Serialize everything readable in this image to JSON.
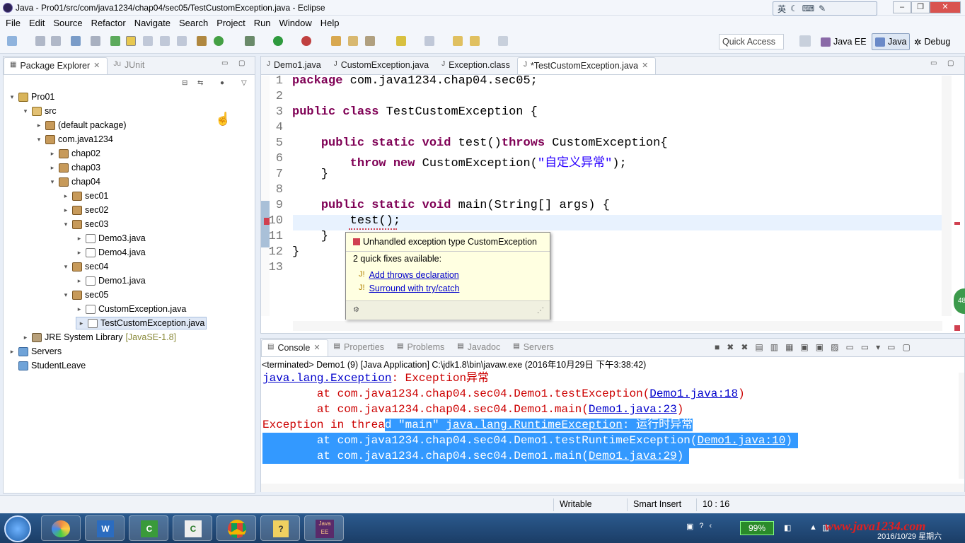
{
  "window": {
    "title": "Java - Pro01/src/com/java1234/chap04/sec05/TestCustomException.java - Eclipse",
    "ime_label": "英"
  },
  "menu": [
    "File",
    "Edit",
    "Source",
    "Refactor",
    "Navigate",
    "Search",
    "Project",
    "Run",
    "Window",
    "Help"
  ],
  "toolbar": {
    "quick_access": "Quick Access",
    "perspectives": [
      "Java EE",
      "Java",
      "Debug"
    ]
  },
  "explorer": {
    "tabs": [
      "Package Explorer",
      "JUnit"
    ],
    "tree": [
      {
        "label": "Pro01",
        "icon": "project-icon",
        "depth": 0,
        "twisty": "▾"
      },
      {
        "label": "src",
        "icon": "source-folder-icon",
        "depth": 1,
        "twisty": "▾"
      },
      {
        "label": "(default package)",
        "icon": "package-icon",
        "depth": 2,
        "twisty": "▸"
      },
      {
        "label": "com.java1234",
        "icon": "package-icon",
        "depth": 2,
        "twisty": "▾"
      },
      {
        "label": "chap02",
        "icon": "package-icon",
        "depth": 3,
        "twisty": "▸"
      },
      {
        "label": "chap03",
        "icon": "package-icon",
        "depth": 3,
        "twisty": "▸"
      },
      {
        "label": "chap04",
        "icon": "package-icon",
        "depth": 3,
        "twisty": "▾"
      },
      {
        "label": "sec01",
        "icon": "package-icon",
        "depth": 4,
        "twisty": "▸"
      },
      {
        "label": "sec02",
        "icon": "package-icon",
        "depth": 4,
        "twisty": "▸"
      },
      {
        "label": "sec03",
        "icon": "package-icon",
        "depth": 4,
        "twisty": "▾"
      },
      {
        "label": "Demo3.java",
        "icon": "java-file-icon",
        "depth": 5,
        "twisty": "▸"
      },
      {
        "label": "Demo4.java",
        "icon": "java-file-icon",
        "depth": 5,
        "twisty": "▸"
      },
      {
        "label": "sec04",
        "icon": "package-icon",
        "depth": 4,
        "twisty": "▾"
      },
      {
        "label": "Demo1.java",
        "icon": "java-file-icon",
        "depth": 5,
        "twisty": "▸"
      },
      {
        "label": "sec05",
        "icon": "package-icon",
        "depth": 4,
        "twisty": "▾"
      },
      {
        "label": "CustomException.java",
        "icon": "java-file-icon",
        "depth": 5,
        "twisty": "▸"
      },
      {
        "label": "TestCustomException.java",
        "icon": "java-file-icon",
        "depth": 5,
        "twisty": "▸",
        "selected": true
      },
      {
        "label": "JRE System Library",
        "suffix": "[JavaSE-1.8]",
        "icon": "library-icon",
        "depth": 1,
        "twisty": "▸"
      },
      {
        "label": "Servers",
        "icon": "folder-icon",
        "depth": 0,
        "twisty": "▸"
      },
      {
        "label": "StudentLeave",
        "icon": "folder-icon",
        "depth": 0,
        "twisty": ""
      }
    ]
  },
  "editor": {
    "tabs": [
      {
        "label": "Demo1.java",
        "active": false
      },
      {
        "label": "CustomException.java",
        "active": false
      },
      {
        "label": "Exception.class",
        "active": false
      },
      {
        "label": "*TestCustomException.java",
        "active": true
      }
    ],
    "line_numbers": [
      "1",
      "2",
      "3",
      "4",
      "5",
      "6",
      "7",
      "8",
      "9",
      "10",
      "11",
      "12",
      "13"
    ],
    "lines": [
      [
        {
          "t": "package",
          "c": "kw"
        },
        {
          "t": " com.java1234.chap04.sec05;"
        }
      ],
      [],
      [
        {
          "t": "public",
          "c": "kw"
        },
        {
          "t": " "
        },
        {
          "t": "class",
          "c": "kw"
        },
        {
          "t": " TestCustomException {"
        }
      ],
      [],
      [
        {
          "t": "    "
        },
        {
          "t": "public",
          "c": "kw"
        },
        {
          "t": " "
        },
        {
          "t": "static",
          "c": "kw"
        },
        {
          "t": " "
        },
        {
          "t": "void",
          "c": "kw"
        },
        {
          "t": " test()"
        },
        {
          "t": "throws",
          "c": "kw"
        },
        {
          "t": " CustomException{"
        }
      ],
      [
        {
          "t": "        "
        },
        {
          "t": "throw",
          "c": "kw"
        },
        {
          "t": " "
        },
        {
          "t": "new",
          "c": "kw"
        },
        {
          "t": " CustomException("
        },
        {
          "t": "\"自定义异常\"",
          "c": "str"
        },
        {
          "t": ");"
        }
      ],
      [
        {
          "t": "    }"
        }
      ],
      [],
      [
        {
          "t": "    "
        },
        {
          "t": "public",
          "c": "kw"
        },
        {
          "t": " "
        },
        {
          "t": "static",
          "c": "kw"
        },
        {
          "t": " "
        },
        {
          "t": "void",
          "c": "kw"
        },
        {
          "t": " main(String[] args) {"
        }
      ],
      [
        {
          "t": "        test();"
        }
      ],
      [
        {
          "t": "    }"
        }
      ],
      [
        {
          "t": "}"
        }
      ],
      []
    ],
    "hover": {
      "title": "Unhandled exception type CustomException",
      "subtitle": "2 quick fixes available:",
      "fixes": [
        "Add throws declaration",
        "Surround with try/catch"
      ]
    }
  },
  "console": {
    "tabs": [
      "Console",
      "Properties",
      "Problems",
      "Javadoc",
      "Servers"
    ],
    "header": "<terminated> Demo1 (9) [Java Application] C:\\jdk1.8\\bin\\javaw.exe (2016年10月29日 下午3:38:42)",
    "lines": [
      {
        "parts": [
          {
            "t": "java.lang.Exception",
            "c": "clink"
          },
          {
            "t": ": Exception异常",
            "c": "err"
          }
        ],
        "sel": false
      },
      {
        "parts": [
          {
            "t": "        at com.java1234.chap04.sec04.Demo1.testException(",
            "c": "err"
          },
          {
            "t": "Demo1.java:18",
            "c": "clink"
          },
          {
            "t": ")",
            "c": "err"
          }
        ],
        "sel": false
      },
      {
        "parts": [
          {
            "t": "        at com.java1234.chap04.sec04.Demo1.main(",
            "c": "err"
          },
          {
            "t": "Demo1.java:23",
            "c": "clink"
          },
          {
            "t": ")",
            "c": "err"
          }
        ],
        "sel": false
      },
      {
        "parts": [
          {
            "t": "Exception in threa",
            "c": "err"
          },
          {
            "t": "d \"main\" ",
            "c": "sel"
          },
          {
            "t": "java.lang.RuntimeException",
            "c": "sel clink"
          },
          {
            "t": ": 运行时异常",
            "c": "sel"
          }
        ],
        "sel": false
      },
      {
        "parts": [
          {
            "t": "        at com.java1234.chap04.sec04.Demo1.testRuntimeException(",
            "c": "sel"
          },
          {
            "t": "Demo1.java:10",
            "c": "sel clink"
          },
          {
            "t": ")",
            "c": "sel"
          }
        ],
        "sel": true
      },
      {
        "parts": [
          {
            "t": "        at com.java1234.chap04.sec04.Demo1.main(",
            "c": "sel"
          },
          {
            "t": "Demo1.java:29",
            "c": "sel clink"
          },
          {
            "t": ")",
            "c": "sel"
          }
        ],
        "sel": true
      }
    ]
  },
  "status": {
    "writable": "Writable",
    "insert_mode": "Smart Insert",
    "position": "10 : 16"
  },
  "taskbar": {
    "battery": "99%",
    "watermark": "www.java1234.com",
    "date": "2016/10/29 星期六",
    "side_badge": "48"
  }
}
